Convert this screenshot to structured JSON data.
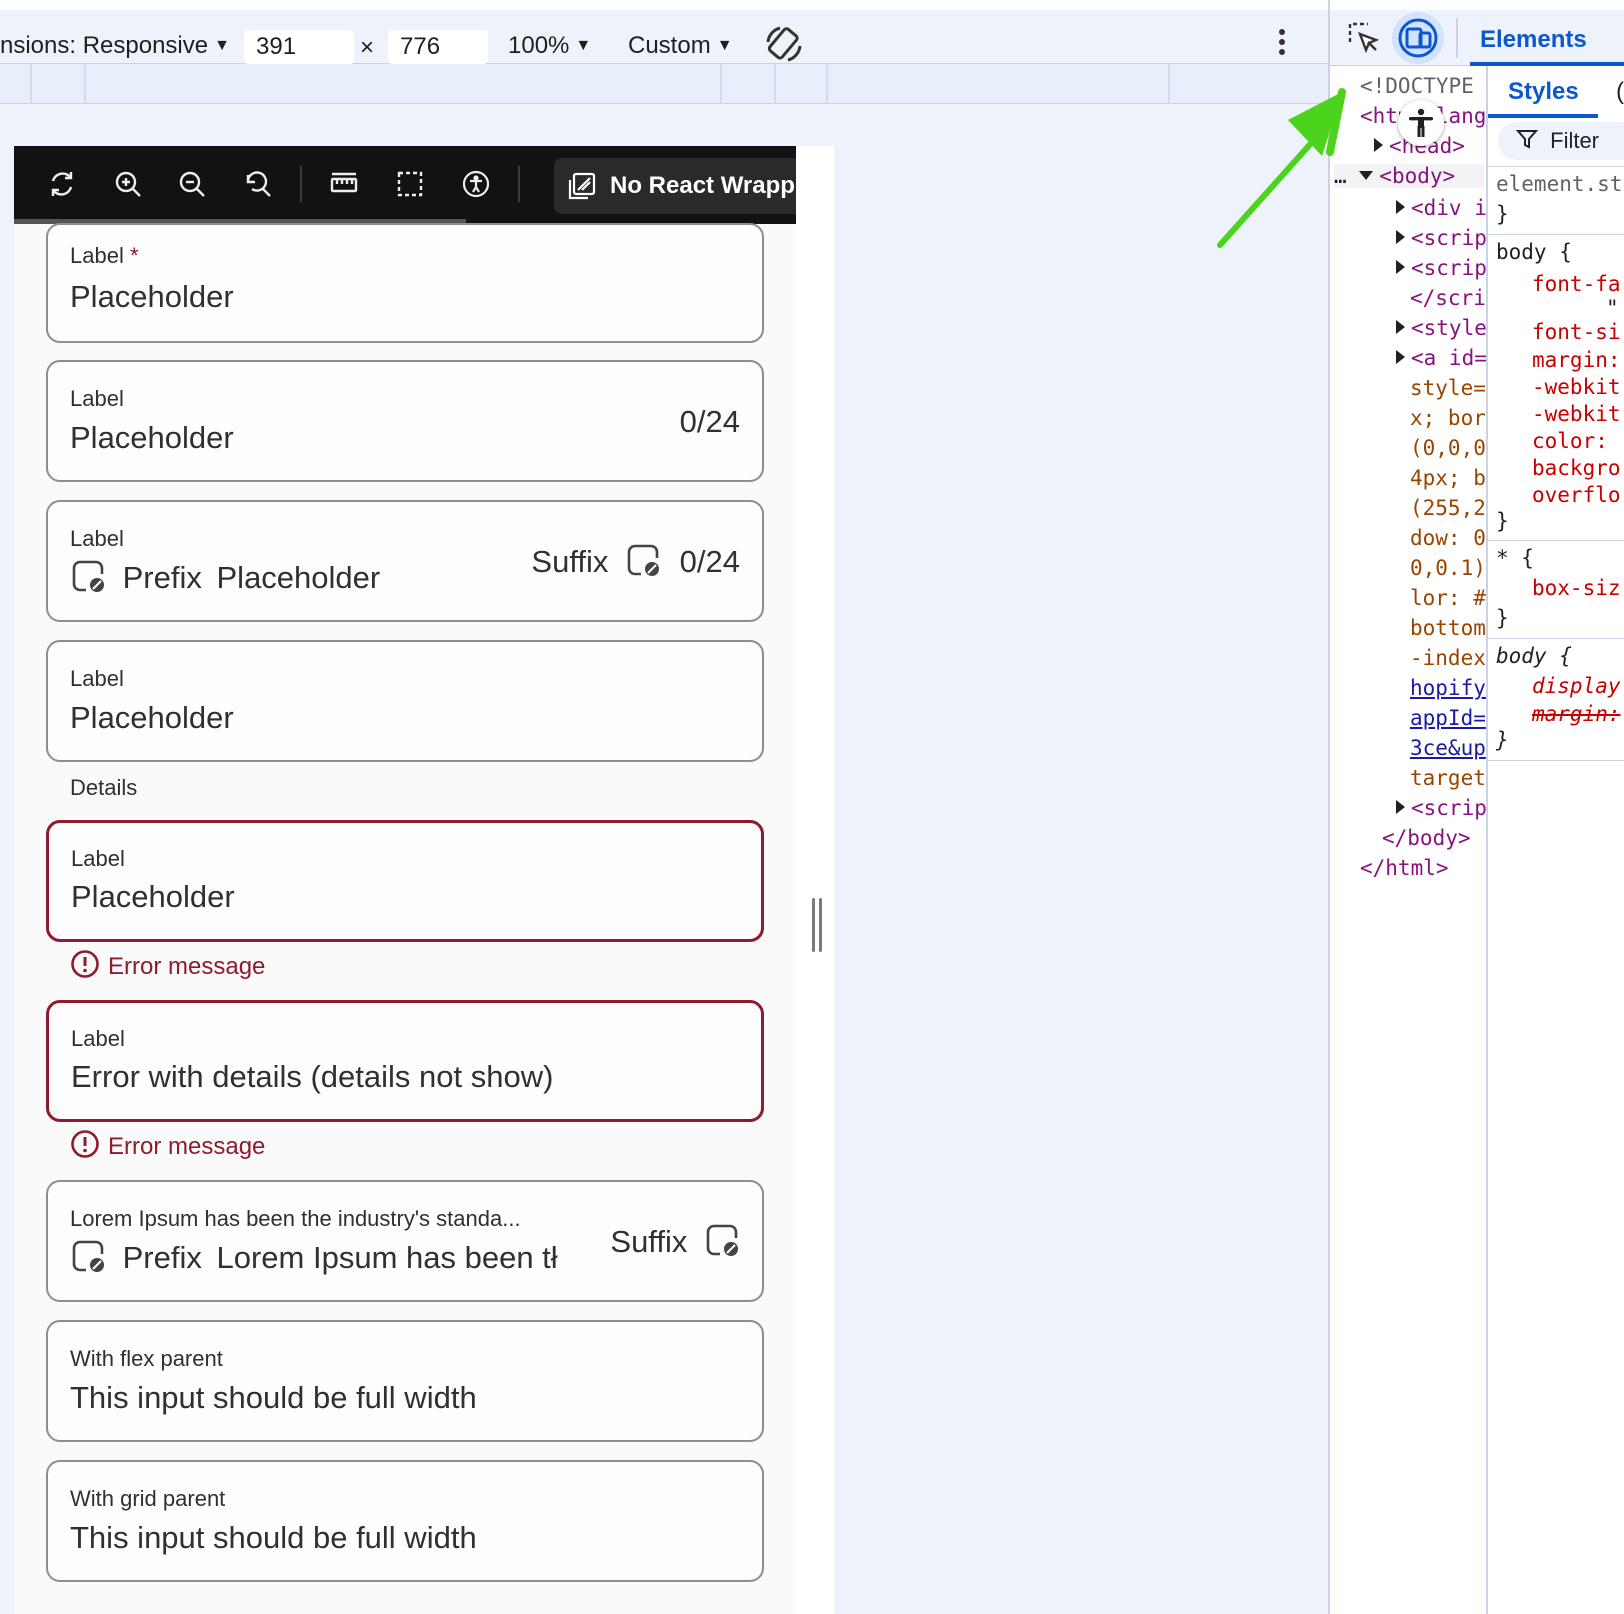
{
  "device_toolbar": {
    "dimensions_label": "nsions: Responsive",
    "width": "391",
    "times": "×",
    "height": "776",
    "zoom": "100%",
    "throttle": "Custom"
  },
  "storybook_toolbar": {
    "wrap_button_label": "No React Wrapp"
  },
  "fields": [
    {
      "label": "Label",
      "required_mark": "*",
      "value": "Placeholder"
    },
    {
      "label": "Label",
      "value": "Placeholder",
      "counter": "0/24"
    },
    {
      "label": "Label",
      "prefix": "Prefix",
      "value": "Placeholder",
      "suffix": "Suffix",
      "counter": "0/24"
    },
    {
      "label": "Label",
      "value": "Placeholder",
      "details": "Details"
    },
    {
      "label": "Label",
      "value": "Placeholder",
      "error": "Error message"
    },
    {
      "label": "Label",
      "value": "Error with details (details not show)",
      "error": "Error message"
    },
    {
      "label": "Lorem Ipsum has been the industry's standa...",
      "prefix": "Prefix",
      "value": "Lorem Ipsum has been tł",
      "suffix": "Suffix"
    },
    {
      "label": "With flex parent",
      "value": "This input should be full width"
    },
    {
      "label": "With grid parent",
      "value": "This input should be full width"
    }
  ],
  "devtools": {
    "tabs": {
      "elements": "Elements",
      "styles": "Styles"
    },
    "filter_placeholder": "Filter",
    "dom_lines": [
      "<!DOCTYPE",
      "<html lang",
      "<head>",
      "<body>",
      "<div i",
      "<scrip",
      "<scrip",
      "</scri",
      "<style",
      "<a id=",
      "style=",
      "x; bor",
      "(0,0,0",
      "4px; b",
      "(255,2",
      "dow: 0",
      "0,0.1)",
      "lor: #",
      "bottom",
      "-index",
      "hopify",
      "appId=",
      "3ce&up",
      "target",
      "<scrip",
      "</body>",
      "</html>"
    ],
    "style_lines": [
      "element.st",
      "}",
      "body {",
      "font-fa",
      "\"",
      "font-si",
      "margin:",
      "-webkit",
      "-webkit",
      "color:",
      "backgro",
      "overflo",
      "}",
      "* {",
      "box-siz",
      "}",
      "body {",
      "display",
      "margin:",
      "}"
    ]
  },
  "colors": {
    "error": "#8e1b2e",
    "devtools_blue": "#0b57d0",
    "annotation_arrow": "#4cd31c"
  }
}
